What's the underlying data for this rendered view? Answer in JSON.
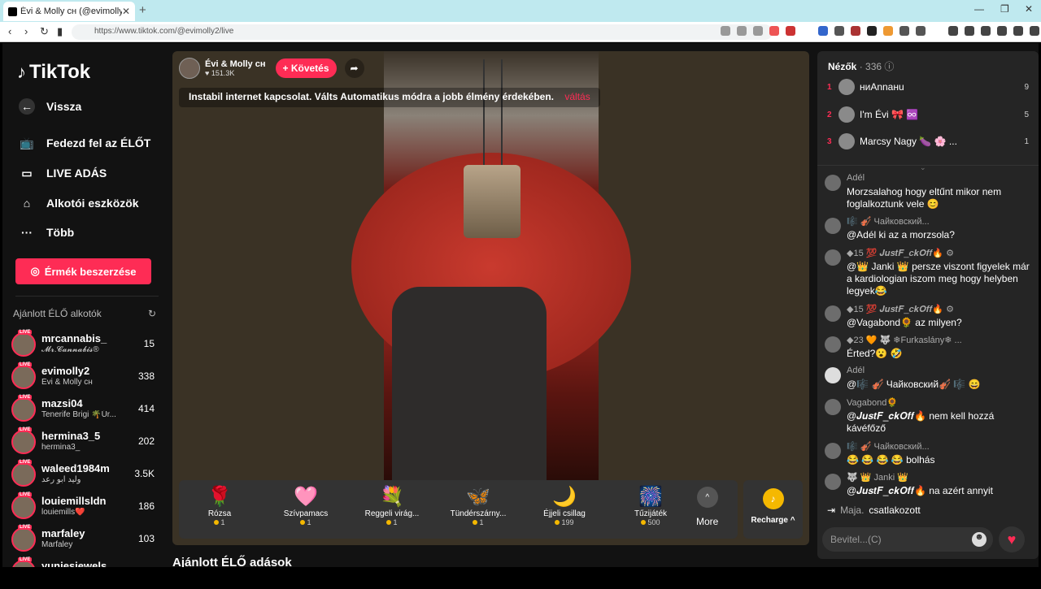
{
  "browser": {
    "tab_title": "Évi & Molly ᴄʜ (@evimolly2)",
    "url": "https://www.tiktok.com/@evimolly2/live"
  },
  "sidebar": {
    "logo": "TikTok",
    "nav": [
      {
        "label": "Vissza",
        "icon": "back-arrow-icon"
      },
      {
        "label": "Fedezd fel az ÉLŐT",
        "icon": "tv-icon"
      },
      {
        "label": "LIVE ADÁS",
        "icon": "camera-icon"
      },
      {
        "label": "Alkotói eszközök",
        "icon": "creator-tools-icon"
      },
      {
        "label": "Több",
        "icon": "more-dots-icon"
      }
    ],
    "coins_button": "Érmék beszerzése",
    "recommended_title": "Ajánlott ÉLŐ alkotók",
    "live_badge": "LIVE",
    "creators": [
      {
        "name": "mrcannabis_",
        "sub": "𝓜𝓻.𝓒𝓪𝓷𝓷𝓪𝓫𝓲𝓼®",
        "count": "15"
      },
      {
        "name": "evimolly2",
        "sub": "Évi & Molly ᴄʜ",
        "count": "338"
      },
      {
        "name": "mazsi04",
        "sub": "Tenerife Brigi 🌴Úr...",
        "count": "414"
      },
      {
        "name": "hermina3_5",
        "sub": "hermina3_",
        "count": "202"
      },
      {
        "name": "waleed1984m",
        "sub": "وليد ابو رعد",
        "count": "3.5K"
      },
      {
        "name": "louiemillsldn",
        "sub": "louiemills❤️",
        "count": "186"
      },
      {
        "name": "marfaley",
        "sub": "Marfaley",
        "count": "103"
      },
      {
        "name": "yuniesjewels",
        "sub": "",
        "count": ""
      }
    ]
  },
  "player": {
    "host_name": "Évi & Molly ᴄʜ",
    "host_likes": "♥ 151.3K",
    "follow_label": "+ Követés",
    "warning": "Instabil internet kapcsolat. Válts Automatikus módra a jobb élmény érdekében.",
    "switch_label": "váltás",
    "gifts": [
      {
        "name": "Rózsa",
        "price": "1",
        "icon": "🌹"
      },
      {
        "name": "Szívpamacs",
        "price": "1",
        "icon": "🩷"
      },
      {
        "name": "Reggeli virág...",
        "price": "1",
        "icon": "💐"
      },
      {
        "name": "Tündérszárny...",
        "price": "1",
        "icon": "🦋"
      },
      {
        "name": "Éjjeli csillag",
        "price": "199",
        "icon": "🌙"
      },
      {
        "name": "Tűzijáték",
        "price": "500",
        "icon": "🎆"
      }
    ],
    "more_label": "More",
    "recharge_label": "Recharge ^"
  },
  "suggested_title": "Ajánlott ÉLŐ adások",
  "chat": {
    "viewers_title": "Nézők",
    "viewers_count": "· 336",
    "top_viewers": [
      {
        "rank": "1",
        "name": "ниАnnaнu",
        "score": "9"
      },
      {
        "rank": "2",
        "name": "I'm Évi 🎀 ♾️",
        "score": "5"
      },
      {
        "rank": "3",
        "name": "Marcsy Nagy 🍆 🌸 ...",
        "score": "1"
      }
    ],
    "messages": [
      {
        "user": "Adél",
        "text": "Morzsalahog hogy eltűnt mikor nem foglalkoztunk vele 😊"
      },
      {
        "user": "🎼 🎻 Чайковский...",
        "text": "@Adél ki az a morzsola?"
      },
      {
        "user": "◆15 💯 𝑱𝒖𝒔𝒕𝑭_𝒄𝒌𝑶𝒇𝒇🔥 ⚙",
        "text": "@👑 Janki 👑 persze viszont figyelek már a kardiologian iszom meg hogy helyben legyek😂"
      },
      {
        "user": "◆15 💯 𝑱𝒖𝒔𝒕𝑭_𝒄𝒌𝑶𝒇𝒇🔥 ⚙",
        "text": "@Vagabond🌻 az milyen?"
      },
      {
        "user": "◆23 🧡 🐺 ❄Furkaslány❄ ...",
        "text": "Érted?😮 🤣"
      },
      {
        "user": "Adél",
        "text": "@🎼 🎻 Чайковский🎻 🎼 😄"
      },
      {
        "user": "Vagabond🌻",
        "text": "@𝑱𝒖𝒔𝒕𝑭_𝒄𝒌𝑶𝒇𝒇🔥 nem kell hozzá kávéfőző"
      },
      {
        "user": "🎼 🎻 Чайковский...",
        "text": "😂 😂 😂 😂 bolhás"
      },
      {
        "user": "🐺 👑 Janki 👑",
        "text": "@𝑱𝒖𝒔𝒕𝑭_𝒄𝒌𝑶𝒇𝒇🔥 na azért annyit"
      }
    ],
    "system_user": "Maja.",
    "system_text": "csatlakozott",
    "input_placeholder": "Bevitel...(C)"
  }
}
